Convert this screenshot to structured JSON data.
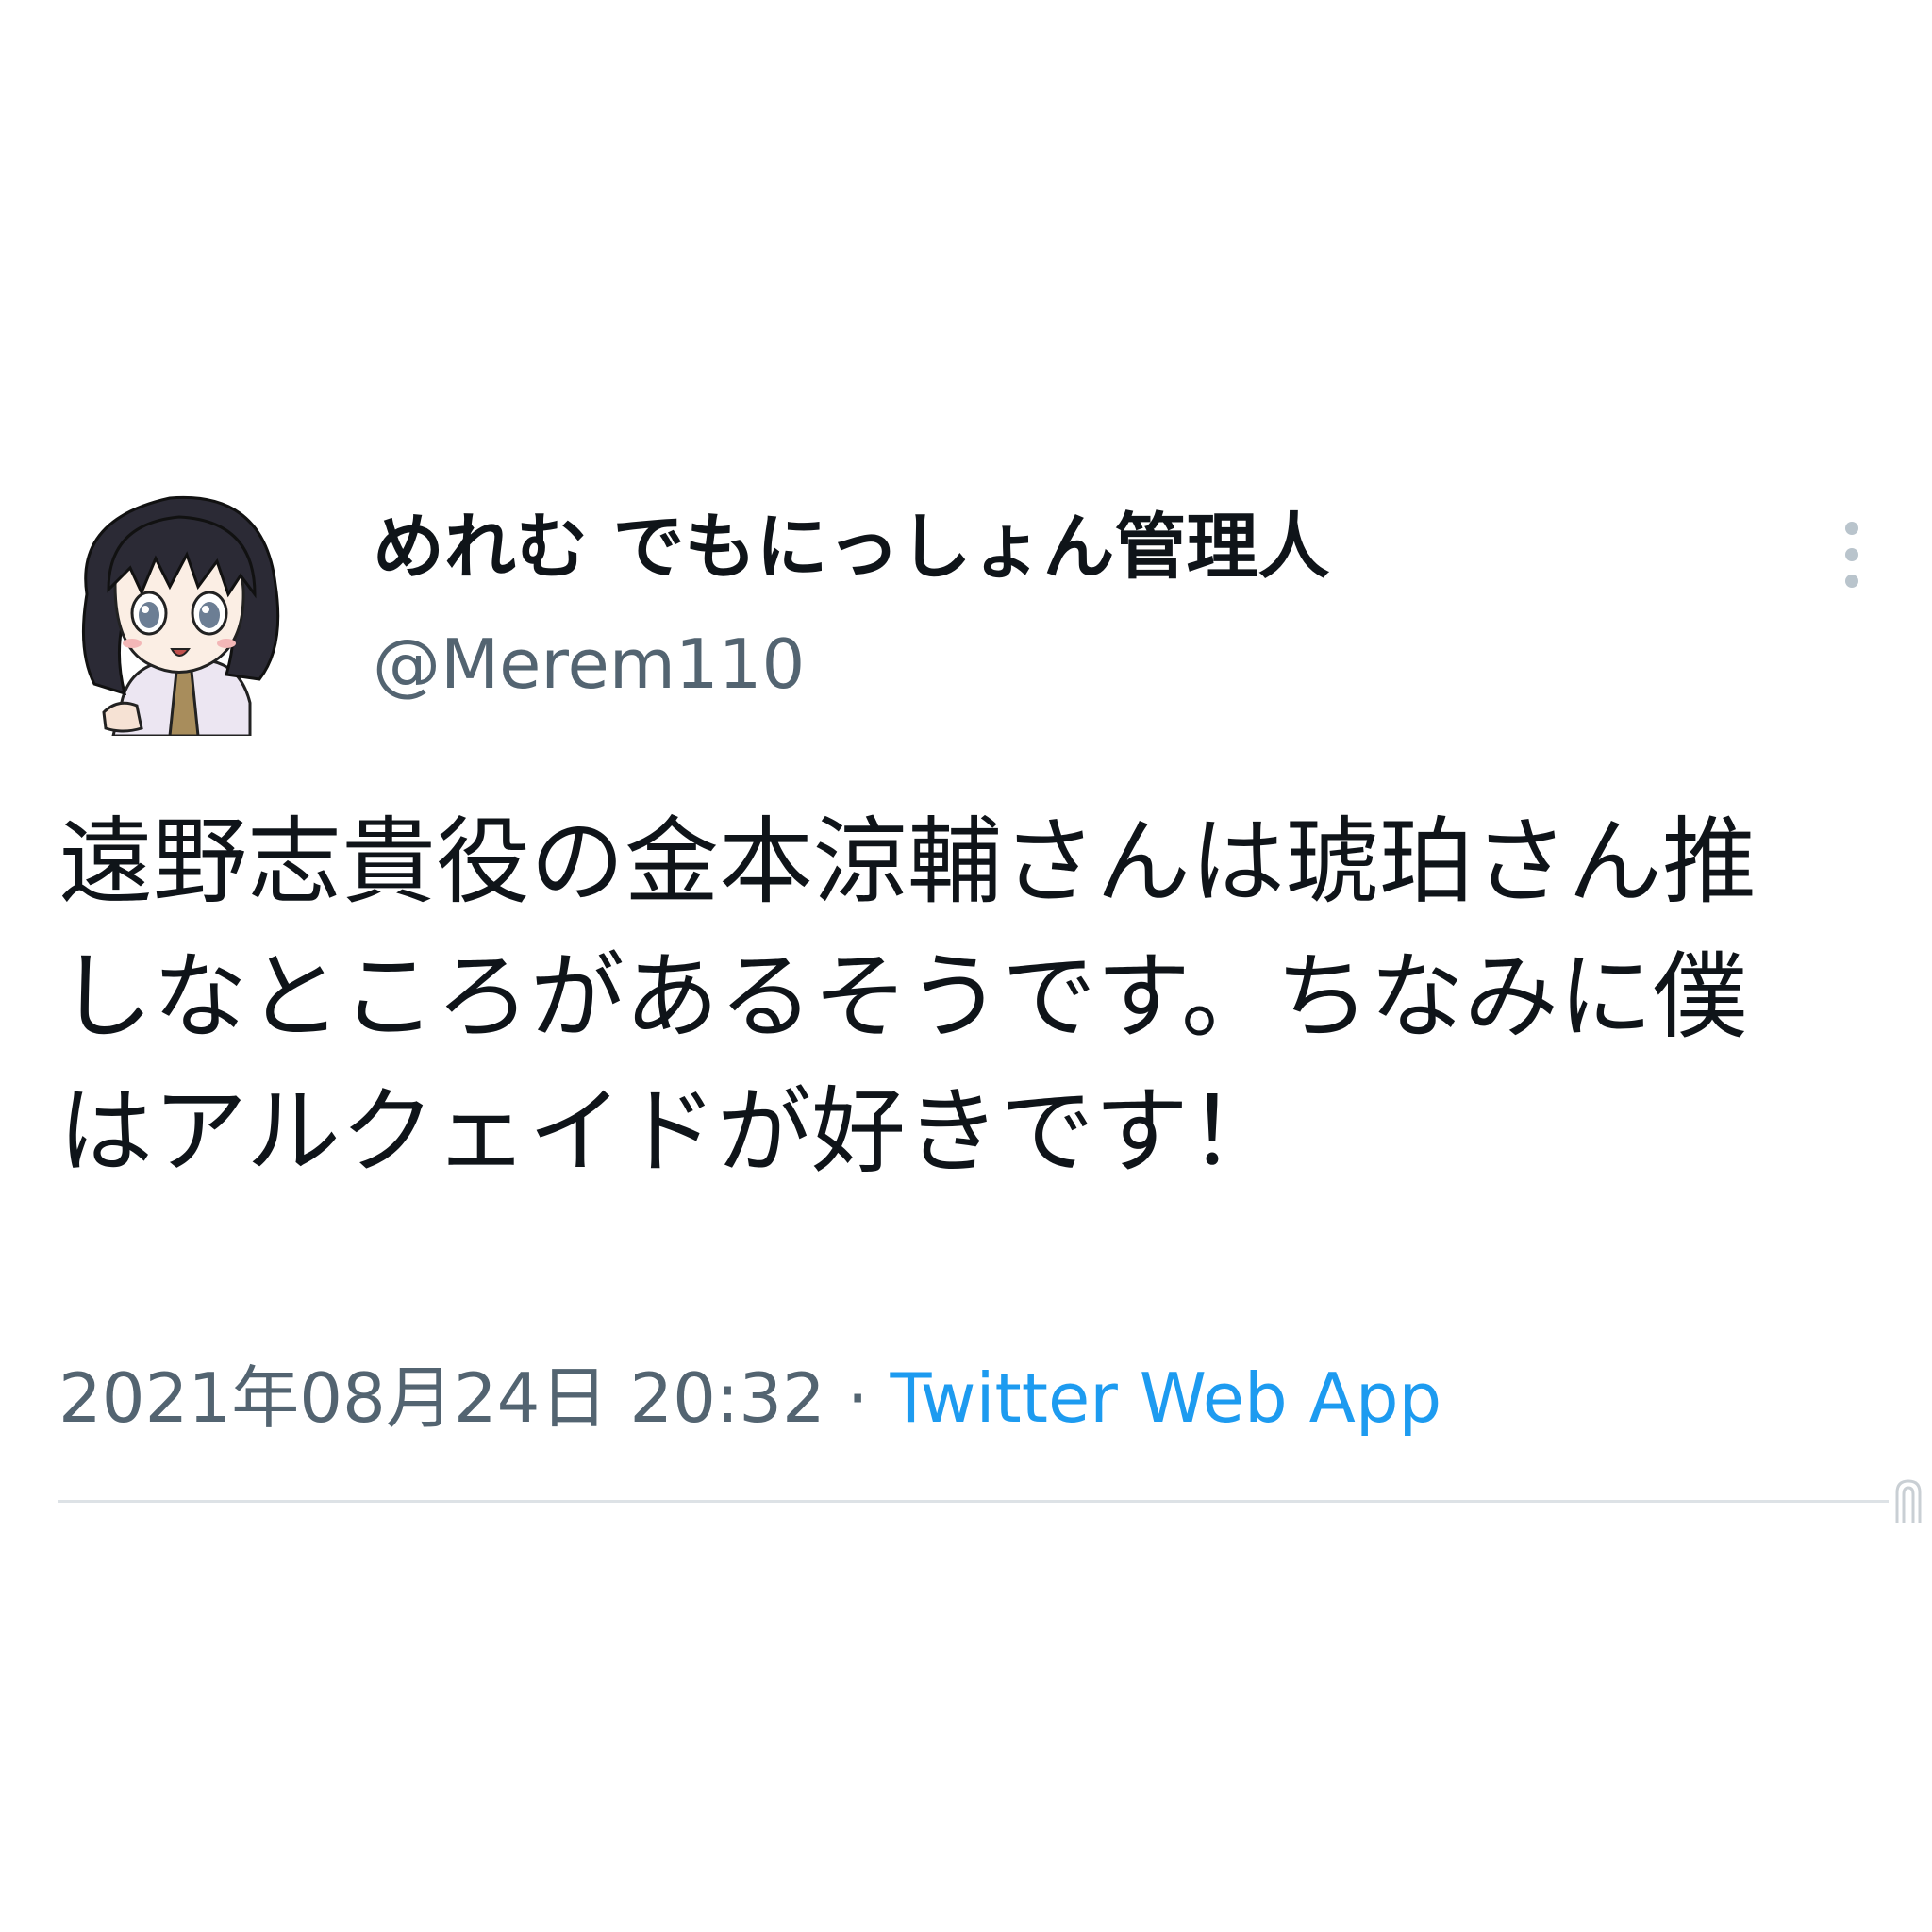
{
  "tweet": {
    "author": {
      "display_name": "めれむ でもにっしょん管理人",
      "handle": "@Merem110",
      "avatar": "anime-character-avatar"
    },
    "text": "遠野志貴役の金本涼輔さんは琥珀さん推しなところがあるそうです。ちなみに僕はアルクェイドが好きです！",
    "meta": {
      "timestamp": "2021年08月24日 20:32",
      "separator": "·",
      "source": "Twitter Web App"
    },
    "more_icon": "more-vertical-icon"
  },
  "colors": {
    "text_primary": "#0f1419",
    "text_secondary": "#536471",
    "link": "#1d9bf0",
    "divider": "#dde2e6"
  }
}
